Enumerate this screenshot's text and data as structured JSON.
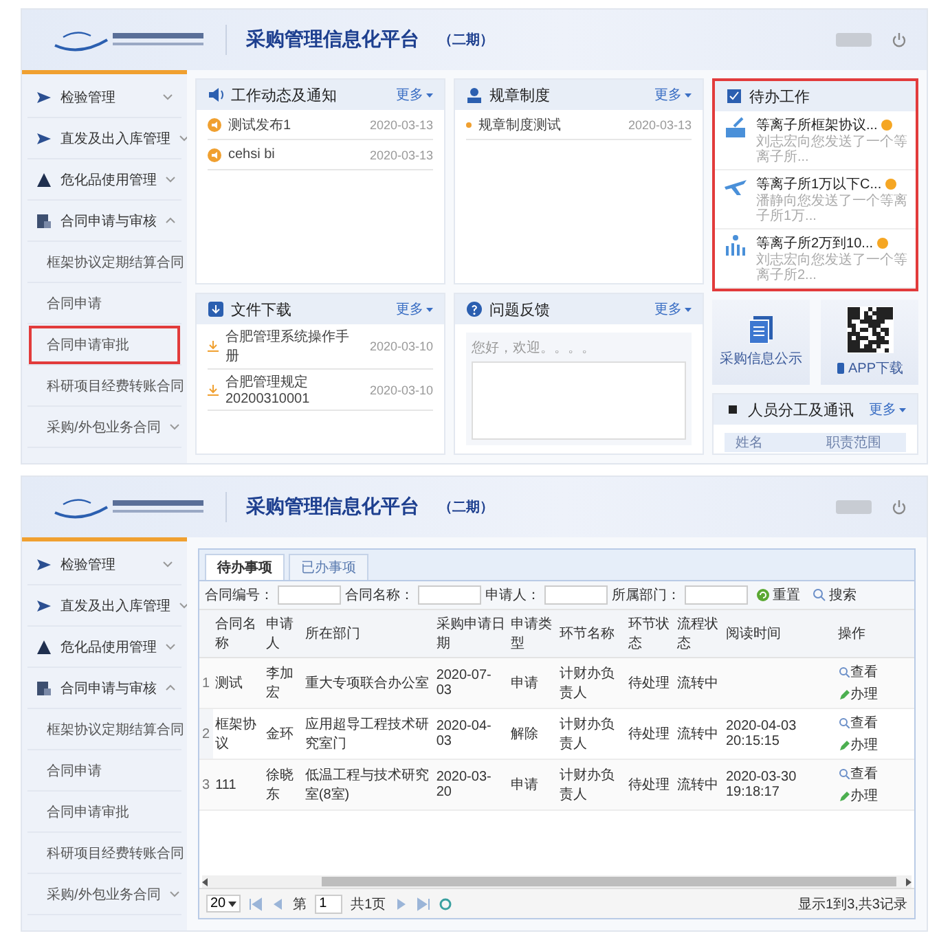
{
  "screens": [
    {
      "kind": "dashboard",
      "header": {
        "title": "采购管理信息化平台",
        "edition": "（二期）"
      },
      "sidebar": {
        "items": [
          {
            "label": "检验管理",
            "expanded": false
          },
          {
            "label": "直发及出入库管理",
            "expanded": false
          },
          {
            "label": "危化品使用管理",
            "expanded": false
          },
          {
            "label": "合同申请与审核",
            "expanded": true,
            "children": [
              {
                "label": "框架协议定期结算合同",
                "highlighted": false
              },
              {
                "label": "合同申请",
                "highlighted": false
              },
              {
                "label": "合同申请审批",
                "highlighted": true
              },
              {
                "label": "科研项目经费转账合同",
                "highlighted": false
              },
              {
                "label": "采购/外包业务合同",
                "highlighted": false,
                "expanded": false
              }
            ]
          }
        ]
      },
      "notices": {
        "title": "工作动态及通知",
        "more": "更多",
        "items": [
          {
            "title": "测试发布1",
            "date": "2020-03-13"
          },
          {
            "title": "cehsi bi",
            "date": "2020-03-13"
          }
        ]
      },
      "rules": {
        "title": "规章制度",
        "more": "更多",
        "items": [
          {
            "title": "规章制度测试",
            "date": "2020-03-13"
          }
        ]
      },
      "downloads": {
        "title": "文件下载",
        "more": "更多",
        "items": [
          {
            "title": "合肥管理系统操作手册",
            "date": "2020-03-10"
          },
          {
            "title": "合肥管理规定20200310001",
            "date": "2020-03-10"
          }
        ]
      },
      "feedback": {
        "title": "问题反馈",
        "more": "更多",
        "greeting": "您好，欢迎。。。。"
      },
      "todo": {
        "title": "待办工作",
        "highlighted": true,
        "items": [
          {
            "title": "等离子所框架协议...",
            "subtitle": "刘志宏向您发送了一个等离子所..."
          },
          {
            "title": "等离子所1万以下C...",
            "subtitle": "潘静向您发送了一个等离子所1万..."
          },
          {
            "title": "等离子所2万到10...",
            "subtitle": "刘志宏向您发送了一个等离子所2..."
          }
        ]
      },
      "tiles": [
        {
          "label": "采购信息公示"
        },
        {
          "label": "APP下载"
        }
      ],
      "staff": {
        "title": "人员分工及通讯",
        "more": "更多",
        "columns": [
          "姓名",
          "职责范围"
        ]
      }
    },
    {
      "kind": "list",
      "header": {
        "title": "采购管理信息化平台",
        "edition": "（二期）"
      },
      "sidebar": {
        "items": [
          {
            "label": "检验管理",
            "expanded": false
          },
          {
            "label": "直发及出入库管理",
            "expanded": false
          },
          {
            "label": "危化品使用管理",
            "expanded": false
          },
          {
            "label": "合同申请与审核",
            "expanded": true,
            "children": [
              {
                "label": "框架协议定期结算合同",
                "highlighted": false
              },
              {
                "label": "合同申请",
                "highlighted": false
              },
              {
                "label": "合同申请审批",
                "highlighted": false
              },
              {
                "label": "科研项目经费转账合同",
                "highlighted": false
              },
              {
                "label": "采购/外包业务合同",
                "highlighted": false,
                "expanded": false
              }
            ]
          }
        ]
      },
      "tabs": [
        {
          "label": "待办事项",
          "selected": true
        },
        {
          "label": "已办事项",
          "selected": false
        }
      ],
      "filters": [
        {
          "label": "合同编号："
        },
        {
          "label": "合同名称："
        },
        {
          "label": "申请人："
        },
        {
          "label": "所属部门："
        }
      ],
      "filter_buttons": [
        {
          "kind": "reset",
          "label": "重置"
        },
        {
          "kind": "search",
          "label": "搜索"
        }
      ],
      "table": {
        "columns": [
          "合同名称",
          "申请人",
          "所在部门",
          "采购申请日期",
          "申请类型",
          "环节名称",
          "环节状态",
          "流程状态",
          "阅读时间",
          "操作"
        ],
        "rows": [
          {
            "index": "1",
            "cells": [
              "测试",
              "李加宏",
              "重大专项联合办公室",
              "2020-07-03",
              "申请",
              "计财办负责人",
              "待处理",
              "流转中",
              null
            ],
            "actions": [
              "查看",
              "办理"
            ]
          },
          {
            "index": "2",
            "cells": [
              "框架协议",
              "金环",
              "应用超导工程技术研究室门",
              "2020-04-03",
              "解除",
              "计财办负责人",
              "待处理",
              "流转中",
              "2020-04-03 20:15:15"
            ],
            "actions": [
              "查看",
              "办理"
            ]
          },
          {
            "index": "3",
            "cells": [
              "111",
              "徐晓东",
              "低温工程与技术研究室(8室)",
              "2020-03-20",
              "申请",
              "计财办负责人",
              "待处理",
              "流转中",
              "2020-03-30 19:18:17"
            ],
            "actions": [
              "查看",
              "办理"
            ]
          }
        ]
      },
      "pager": {
        "page_size": "20",
        "page_prefix": "第",
        "page": "1",
        "page_total": "共1页",
        "summary": "显示1到3,共3记录"
      }
    }
  ]
}
